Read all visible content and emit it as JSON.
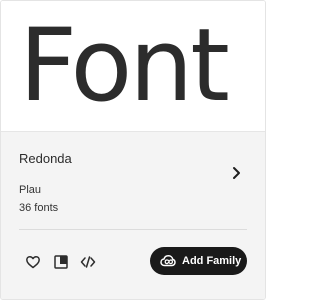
{
  "preview": {
    "sample_text": "Font"
  },
  "family": {
    "name": "Redonda",
    "foundry": "Plau",
    "font_count": "36 fonts"
  },
  "actions": {
    "add_family_label": "Add Family",
    "icons": [
      "heart-icon",
      "specimen-icon",
      "code-icon",
      "creative-cloud-icon",
      "chevron-right-icon"
    ]
  },
  "colors": {
    "card_bg": "#ffffff",
    "info_bg": "#f4f4f4",
    "text": "#2c2c2c",
    "button_bg": "#1a1a1a",
    "button_text": "#ffffff"
  }
}
